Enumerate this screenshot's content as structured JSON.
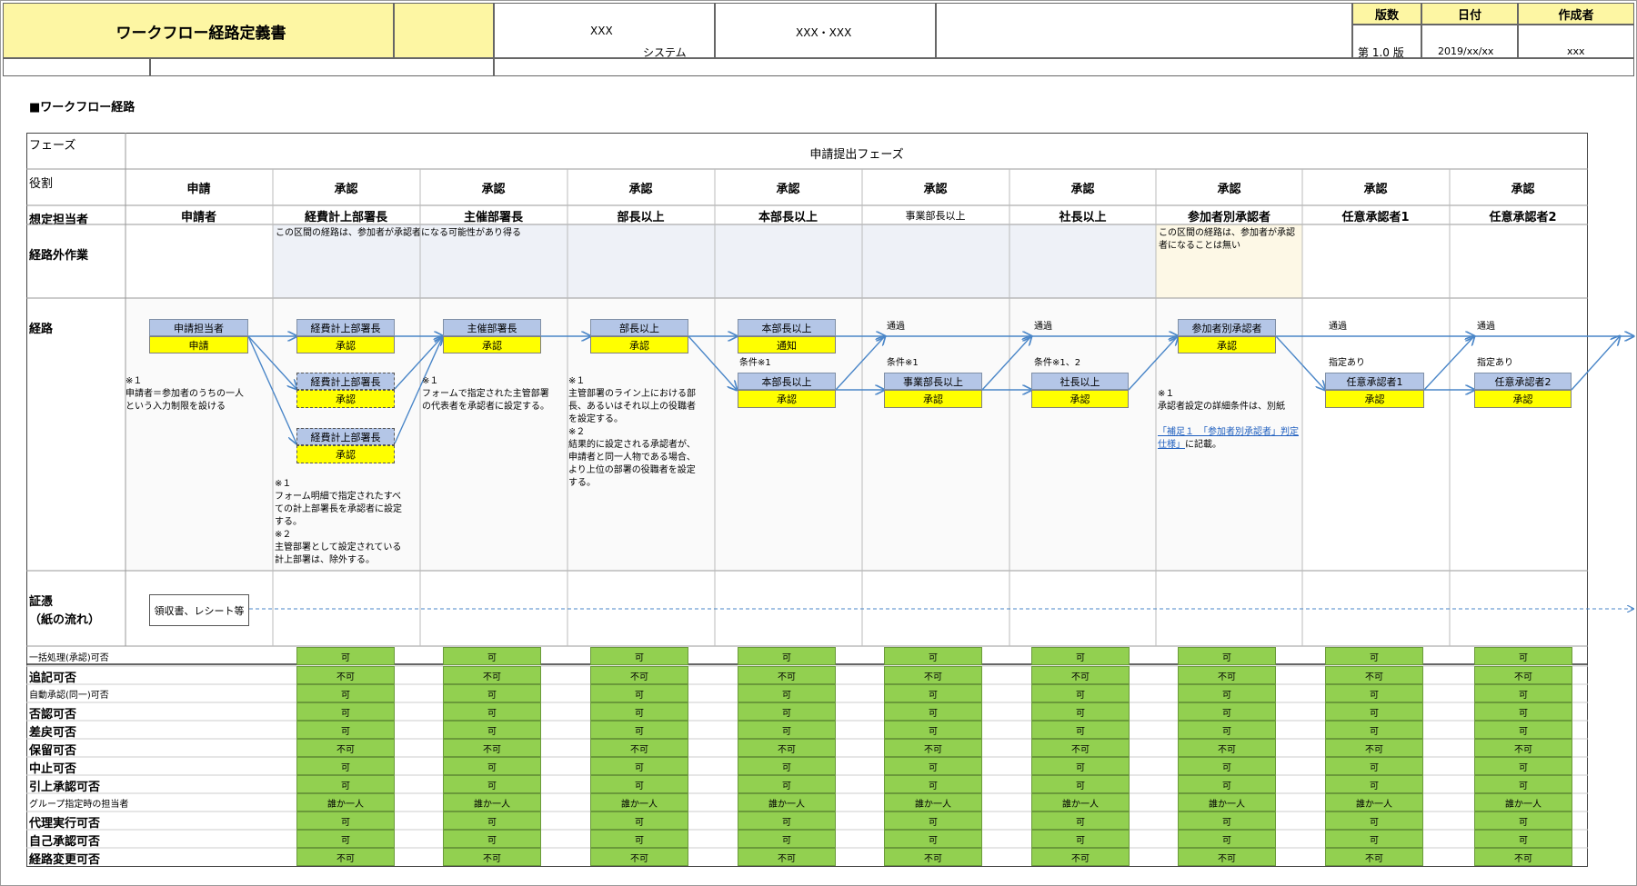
{
  "header": {
    "doc_title": "ワークフロー経路定義書",
    "system_code": "XXX",
    "system_label": "システム",
    "sub_code": "XXX・XXX",
    "version_label": "版数",
    "date_label": "日付",
    "author_label": "作成者",
    "version_value": "第 1.0 版",
    "date_value": "2019/xx/xx",
    "author_value": "xxx"
  },
  "section_title": "■ワークフロー経路",
  "row_labels": {
    "phase": "フェーズ",
    "role": "役割",
    "assignee": "想定担当者",
    "extra_work": "経路外作業",
    "route": "経路",
    "evidence": "証憑\n（紙の流れ）"
  },
  "phase_name": "申請提出フェーズ",
  "columns": [
    {
      "role": "申請",
      "assignee": "申請者"
    },
    {
      "role": "承認",
      "assignee": "経費計上部署長"
    },
    {
      "role": "承認",
      "assignee": "主催部署長"
    },
    {
      "role": "承認",
      "assignee": "部長以上"
    },
    {
      "role": "承認",
      "assignee": "本部長以上"
    },
    {
      "role": "承認",
      "assignee": "事業部長以上"
    },
    {
      "role": "承認",
      "assignee": "社長以上"
    },
    {
      "role": "承認",
      "assignee": "参加者別承認者"
    },
    {
      "role": "承認",
      "assignee": "任意承認者1"
    },
    {
      "role": "承認",
      "assignee": "任意承認者2"
    }
  ],
  "extra_notes": {
    "range1": "この区間の経路は、参加者が承認者になる可能性があり得る",
    "range2": "この区間の経路は、参加者が承認者になることは無い"
  },
  "route": {
    "boxes": {
      "applicant_top": "申請担当者",
      "applicant_bottom": "申請",
      "keihi_top": "経費計上部署長",
      "keihi_bottom": "承認",
      "keihi2_top": "経費計上部署長",
      "keihi2_bottom": "承認",
      "keihi3_top": "経費計上部署長",
      "keihi3_bottom": "承認",
      "shusai_top": "主催部署長",
      "shusai_bottom": "承認",
      "bucho_top": "部長以上",
      "bucho_bottom": "承認",
      "honbu1_top": "本部長以上",
      "honbu1_bottom": "通知",
      "honbu2_top": "本部長以上",
      "honbu2_bottom": "承認",
      "jigyo_top": "事業部長以上",
      "jigyo_bottom": "承認",
      "shacho_top": "社長以上",
      "shacho_bottom": "承認",
      "sanka_top": "参加者別承認者",
      "sanka_bottom": "承認",
      "nini1_top": "任意承認者1",
      "nini1_bottom": "承認",
      "nini2_top": "任意承認者2",
      "nini2_bottom": "承認"
    },
    "labels": {
      "cond1": "条件※1",
      "pass1": "通過",
      "cond_jigyo": "条件※1",
      "pass2": "通過",
      "cond_shacho": "条件※1、2",
      "pass3": "通過",
      "designated1": "指定あり",
      "pass4": "通過",
      "designated2": "指定あり"
    },
    "notes": {
      "applicant": "※１\n申請者＝参加者のうちの一人\nという入力制限を設ける",
      "keihi": "※１\nフォーム明細で指定されたすべ\nての計上部署長を承認者に設定\nする。\n※２\n主管部署として設定されている\n計上部署は、除外する。",
      "shusai": "※１\nフォームで指定された主管部署\nの代表者を承認者に設定する。",
      "bucho": "※１\n主管部署のライン上における部\n長、あるいはそれ以上の役職者\nを設定する。\n※２\n結果的に設定される承認者が、\n申請者と同一人物である場合、\nより上位の部署の役職者を設定\nする。",
      "sanka_pre": "※１\n承認者設定の詳細条件は、別紙",
      "sanka_link": "「補足１　「参加者別承認者」判定仕様」",
      "sanka_post": "に記載。"
    }
  },
  "evidence_box": "領収書、レシート等",
  "permissions": [
    {
      "label": "一括処理(承認)可否",
      "small": true,
      "values": [
        "可",
        "可",
        "可",
        "可",
        "可",
        "可",
        "可",
        "可",
        "可"
      ]
    },
    {
      "label": "追記可否",
      "small": false,
      "values": [
        "不可",
        "不可",
        "不可",
        "不可",
        "不可",
        "不可",
        "不可",
        "不可",
        "不可"
      ]
    },
    {
      "label": "自動承認(同一)可否",
      "small": true,
      "values": [
        "可",
        "可",
        "可",
        "可",
        "可",
        "可",
        "可",
        "可",
        "可"
      ]
    },
    {
      "label": "否認可否",
      "small": false,
      "values": [
        "可",
        "可",
        "可",
        "可",
        "可",
        "可",
        "可",
        "可",
        "可"
      ]
    },
    {
      "label": "差戻可否",
      "small": false,
      "values": [
        "可",
        "可",
        "可",
        "可",
        "可",
        "可",
        "可",
        "可",
        "可"
      ]
    },
    {
      "label": "保留可否",
      "small": false,
      "values": [
        "不可",
        "不可",
        "不可",
        "不可",
        "不可",
        "不可",
        "不可",
        "不可",
        "不可"
      ]
    },
    {
      "label": "中止可否",
      "small": false,
      "values": [
        "可",
        "可",
        "可",
        "可",
        "可",
        "可",
        "可",
        "可",
        "可"
      ]
    },
    {
      "label": "引上承認可否",
      "small": false,
      "values": [
        "可",
        "可",
        "可",
        "可",
        "可",
        "可",
        "可",
        "可",
        "可"
      ]
    },
    {
      "label": "グループ指定時の担当者",
      "small": true,
      "values": [
        "誰か一人",
        "誰か一人",
        "誰か一人",
        "誰か一人",
        "誰か一人",
        "誰か一人",
        "誰か一人",
        "誰か一人",
        "誰か一人"
      ]
    },
    {
      "label": "代理実行可否",
      "small": false,
      "values": [
        "可",
        "可",
        "可",
        "可",
        "可",
        "可",
        "可",
        "可",
        "可"
      ]
    },
    {
      "label": "自己承認可否",
      "small": false,
      "values": [
        "可",
        "可",
        "可",
        "可",
        "可",
        "可",
        "可",
        "可",
        "可"
      ]
    },
    {
      "label": "経路変更可否",
      "small": false,
      "values": [
        "不可",
        "不可",
        "不可",
        "不可",
        "不可",
        "不可",
        "不可",
        "不可",
        "不可"
      ]
    }
  ]
}
